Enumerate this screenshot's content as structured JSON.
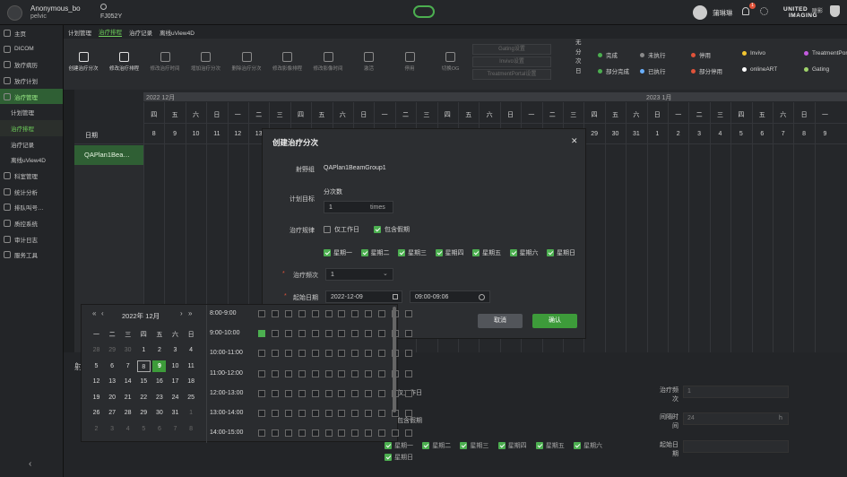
{
  "user": {
    "name": "Anonymous_bo",
    "sub": "pelvic"
  },
  "search": {
    "label": "FJ052Y"
  },
  "header": {
    "right_user": "蒲琳琳",
    "notif_count": "1",
    "brand_line1": "UNITED",
    "brand_line2": "IMAGING",
    "brand_cn": "联影"
  },
  "sidebar": {
    "items": [
      {
        "label": "主页",
        "sub": false
      },
      {
        "label": "DICOM",
        "sub": false
      },
      {
        "label": "放疗病历",
        "sub": false
      },
      {
        "label": "放疗计划",
        "sub": false
      },
      {
        "label": "治疗管理",
        "sub": false,
        "active": true
      },
      {
        "label": "计划管理",
        "sub": true
      },
      {
        "label": "治疗排程",
        "sub": true,
        "active": true
      },
      {
        "label": "治疗记录",
        "sub": true
      },
      {
        "label": "离线uView4D",
        "sub": true
      },
      {
        "label": "科室管理",
        "sub": false
      },
      {
        "label": "统计分析",
        "sub": false
      },
      {
        "label": "排队叫号…",
        "sub": false
      },
      {
        "label": "质控系统",
        "sub": false
      },
      {
        "label": "审计日志",
        "sub": false
      },
      {
        "label": "服务工具",
        "sub": false
      }
    ],
    "collapse": "‹"
  },
  "tabs": [
    {
      "label": "计划管理"
    },
    {
      "label": "治疗排程",
      "active": true
    },
    {
      "label": "治疗记录"
    },
    {
      "label": "离线uView4D"
    }
  ],
  "toolbar": {
    "tools": [
      "创建治疗分次",
      "修改治疗排程",
      "修改治疗时间",
      "增加治疗分次",
      "删除治疗分次",
      "修改影像排程",
      "修改影像时间",
      "激活",
      "停用",
      "切换OG"
    ],
    "gating": "Gating设置",
    "invivo": "Invivo设置",
    "portal": "TreatmentPortal设置"
  },
  "legend": {
    "side": "无分次日",
    "items": [
      {
        "label": "完成",
        "color": "#4caf50"
      },
      {
        "label": "未执行",
        "color": "#8a8a8a"
      },
      {
        "label": "停用",
        "color": "#e0533a"
      },
      {
        "label": "Invivo",
        "color": "#f2c530"
      },
      {
        "label": "TreatmentPortal",
        "color": "#c45be0"
      },
      {
        "label": "部分完成",
        "color": "#4caf50"
      },
      {
        "label": "已执行",
        "color": "#6ab0ff"
      },
      {
        "label": "部分停用",
        "color": "#e0533a"
      },
      {
        "label": "onlineART",
        "color": "#ffffff"
      },
      {
        "label": "Gating",
        "color": "#9fd36b"
      }
    ]
  },
  "grid": {
    "month_left": "2022 12月",
    "month_right": "2023 1月",
    "date_label": "日期",
    "patient": "QAPlan1Bea…",
    "weekdays": [
      "四",
      "五",
      "六",
      "日",
      "一",
      "二",
      "三",
      "四",
      "五",
      "六",
      "日",
      "一",
      "二",
      "三",
      "四",
      "五",
      "六",
      "日",
      "一",
      "二",
      "三",
      "四",
      "五",
      "六",
      "日",
      "一",
      "二",
      "三",
      "四",
      "五",
      "六",
      "日",
      "一",
      "二",
      "三",
      "四",
      "五",
      "六",
      "日"
    ],
    "days": [
      "8",
      "9",
      "10",
      "11",
      "12",
      "13",
      "14",
      "15",
      "16",
      "17",
      "18",
      "19",
      "20",
      "21",
      "22",
      "23",
      "24",
      "25",
      "26",
      "27",
      "28",
      "29",
      "30",
      "31",
      "1",
      "2",
      "3",
      "4",
      "5",
      "6",
      "7",
      "8",
      "9"
    ]
  },
  "modal": {
    "title": "创建治疗分次",
    "group_label": "射野组",
    "group_value": "QAPlan1BeamGroup1",
    "target_label": "计划目标",
    "count_label": "分次数",
    "count_value": "1",
    "count_unit": "times",
    "rule_label": "治疗规律",
    "workday": "仅工作日",
    "holiday": "包含假期",
    "weekdays": [
      "星期一",
      "星期二",
      "星期三",
      "星期四",
      "星期五",
      "星期六",
      "星期日"
    ],
    "freq_label": "治疗频次",
    "freq_value": "1",
    "start_label": "起始日期",
    "start_value": "2022-12-09",
    "time_value": "09:00-09:06",
    "cancel": "取消",
    "confirm": "确认",
    "close": "✕"
  },
  "picker": {
    "month": "2022年 12月",
    "weekheads": [
      "一",
      "二",
      "三",
      "四",
      "五",
      "六",
      "日"
    ],
    "weeks": [
      [
        "28",
        "29",
        "30",
        "1",
        "2",
        "3",
        "4"
      ],
      [
        "5",
        "6",
        "7",
        "8",
        "9",
        "10",
        "11"
      ],
      [
        "12",
        "13",
        "14",
        "15",
        "16",
        "17",
        "18"
      ],
      [
        "19",
        "20",
        "21",
        "22",
        "23",
        "24",
        "25"
      ],
      [
        "26",
        "27",
        "28",
        "29",
        "30",
        "31",
        "1"
      ],
      [
        "2",
        "3",
        "4",
        "5",
        "6",
        "7",
        "8"
      ]
    ],
    "slots": [
      "8:00-9:00",
      "9:00-10:00",
      "10:00-11:00",
      "11:00-12:00",
      "12:00-13:00",
      "13:00-14:00",
      "14:00-15:00"
    ]
  },
  "bottom": {
    "section": "射",
    "fq": "治疗频次",
    "fq_val": "1",
    "interval": "间隔时间",
    "interval_val": "24",
    "interval_unit": "h",
    "start": "起始日期",
    "workday": "仅工作日",
    "holiday": "包含假期",
    "weekdays": [
      "星期一",
      "星期二",
      "星期三",
      "星期四",
      "星期五",
      "星期六",
      "星期日"
    ]
  }
}
